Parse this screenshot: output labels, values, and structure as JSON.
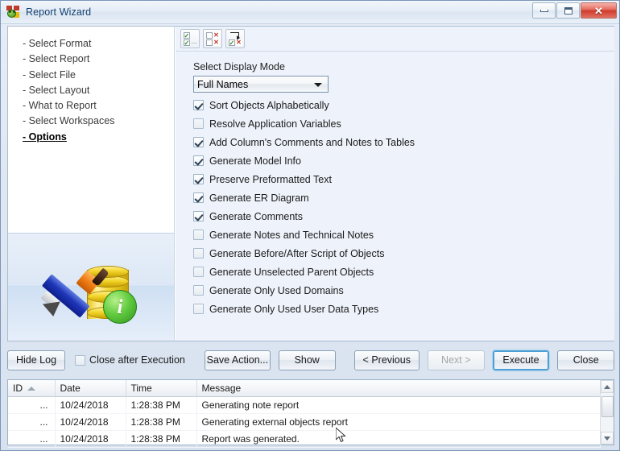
{
  "window": {
    "title": "Report Wizard",
    "app_icon": "report-wizard-icon",
    "controls": {
      "minimize": "minimize-icon",
      "maximize": "maximize-icon",
      "close": "✕"
    }
  },
  "sidebar": {
    "steps": [
      {
        "label": "- Select Format",
        "current": false
      },
      {
        "label": "- Select Report",
        "current": false
      },
      {
        "label": "- Select File",
        "current": false
      },
      {
        "label": "- Select Layout",
        "current": false
      },
      {
        "label": "- What to Report",
        "current": false
      },
      {
        "label": "- Select Workspaces",
        "current": false
      },
      {
        "label": "- Options",
        "current": true
      }
    ],
    "illustration": "pencil-database-info-illustration"
  },
  "toolbar": {
    "buttons": [
      {
        "name": "check-all-icon",
        "tooltip": "Check All"
      },
      {
        "name": "uncheck-all-icon",
        "tooltip": "Uncheck All"
      },
      {
        "name": "invert-selection-icon",
        "tooltip": "Invert Selection"
      }
    ]
  },
  "options": {
    "display_mode_label": "Select Display Mode",
    "display_mode_value": "Full Names",
    "display_mode_options": [
      "Full Names"
    ],
    "checkboxes": [
      {
        "label": "Sort Objects Alphabetically",
        "checked": true
      },
      {
        "label": "Resolve Application Variables",
        "checked": false
      },
      {
        "label": "Add Column's Comments and Notes to Tables",
        "checked": true
      },
      {
        "label": "Generate Model Info",
        "checked": true
      },
      {
        "label": "Preserve Preformatted Text",
        "checked": true
      },
      {
        "label": "Generate ER Diagram",
        "checked": true
      },
      {
        "label": "Generate Comments",
        "checked": true
      },
      {
        "label": "Generate Notes and Technical Notes",
        "checked": false
      },
      {
        "label": "Generate Before/After Script of Objects",
        "checked": false
      },
      {
        "label": "Generate Unselected Parent Objects",
        "checked": false
      },
      {
        "label": "Generate Only Used Domains",
        "checked": false
      },
      {
        "label": "Generate Only Used User Data Types",
        "checked": false
      }
    ]
  },
  "buttonbar": {
    "hide_log": "Hide Log",
    "close_after_execution_label": "Close after Execution",
    "close_after_execution_checked": false,
    "save_action": "Save Action...",
    "show": "Show",
    "previous": "< Previous",
    "next": "Next >",
    "next_disabled": true,
    "execute": "Execute",
    "execute_focused": true,
    "close": "Close"
  },
  "log": {
    "columns": [
      "ID",
      "Date",
      "Time",
      "Message"
    ],
    "sort_column": "ID",
    "sort_direction": "ascending",
    "rows": [
      {
        "id": "...",
        "date": "10/24/2018",
        "time": "1:28:38 PM",
        "message": "Generating note report"
      },
      {
        "id": "...",
        "date": "10/24/2018",
        "time": "1:28:38 PM",
        "message": "Generating external objects report"
      },
      {
        "id": "...",
        "date": "10/24/2018",
        "time": "1:28:38 PM",
        "message": "Report was generated."
      }
    ]
  },
  "colors": {
    "titlebar_text": "#13406e",
    "panel_bg": "#eef3fb",
    "accent_focus": "#4b9fd5",
    "close_button": "#cf3a2b",
    "check_green": "#2f8a22",
    "x_red": "#c0392b"
  }
}
